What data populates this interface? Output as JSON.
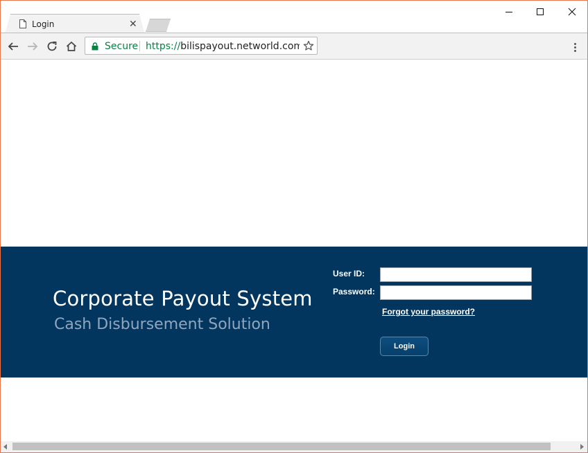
{
  "tab": {
    "title": "Login",
    "close_glyph": "✕"
  },
  "window_controls": {
    "minimize": "minimize-icon",
    "maximize": "maximize-icon",
    "close": "close-icon"
  },
  "toolbar": {
    "back": "back-arrow-icon",
    "forward": "forward-arrow-icon",
    "reload": "reload-icon",
    "home": "home-icon",
    "menu": "three-dot-menu-icon"
  },
  "omnibox": {
    "secure_label": "Secure",
    "url_scheme": "https://",
    "url_host": "bilispayout.networld.com.ph/",
    "secure_color": "#0b8043"
  },
  "page": {
    "title": "Corporate Payout System",
    "subtitle": "Cash Disbursement Solution",
    "user_id_label": "User ID:",
    "password_label": "Password:",
    "user_id_value": "",
    "password_value": "",
    "forgot_link": "Forgot your password?",
    "login_button": "Login",
    "banner_color": "#03365e"
  }
}
